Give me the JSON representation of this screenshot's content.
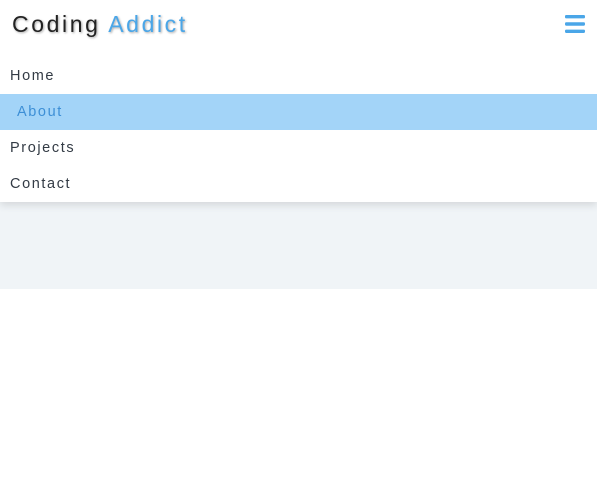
{
  "brand": {
    "part1": "Coding",
    "part2": "Addict"
  },
  "nav": {
    "toggle_icon": "hamburger-menu-icon",
    "items": [
      {
        "label": "Home",
        "active": false
      },
      {
        "label": "About",
        "active": true
      },
      {
        "label": "Projects",
        "active": false
      },
      {
        "label": "Contact",
        "active": false
      }
    ]
  },
  "colors": {
    "accent": "#4aa6e8",
    "active_bg": "#a3d4f8",
    "text": "#333b45",
    "band_bg": "#f0f4f7"
  }
}
